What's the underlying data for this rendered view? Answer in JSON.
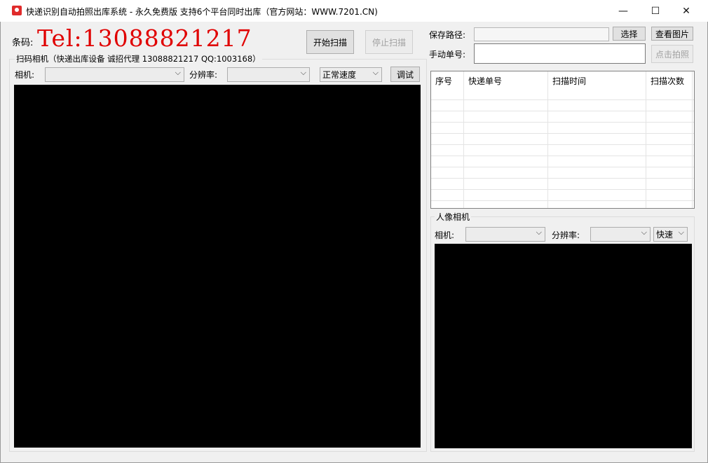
{
  "window": {
    "title": "快递识别自动拍照出库系统 - 永久免费版 支持6个平台同时出库（官方网站：WWW.7201.CN)",
    "minimize_glyph": "—",
    "maximize_glyph": "☐",
    "close_glyph": "✕"
  },
  "barcode": {
    "label": "条码:",
    "value": "Tel:13088821217"
  },
  "toolbar": {
    "start_scan": "开始扫描",
    "stop_scan": "停止扫描"
  },
  "scan_camera": {
    "group_title": "扫码相机（快递出库设备 诚招代理 13088821217 QQ:1003168）",
    "camera_label": "相机:",
    "camera_value": "",
    "resolution_label": "分辨率:",
    "resolution_value": "",
    "speed_value": "正常速度",
    "debug_button": "调试"
  },
  "save": {
    "path_label": "保存路径:",
    "path_value": "",
    "choose_button": "选择",
    "view_button": "查看图片"
  },
  "manual": {
    "label": "手动单号:",
    "value": "",
    "shoot_button": "点击拍照"
  },
  "table": {
    "columns": [
      "序号",
      "快递单号",
      "扫描时间",
      "扫描次数"
    ],
    "rows": []
  },
  "portrait_camera": {
    "group_title": "人像相机",
    "camera_label": "相机:",
    "camera_value": "",
    "resolution_label": "分辨率:",
    "resolution_value": "",
    "speed_value": "快速"
  },
  "colors": {
    "barcode_text": "#e00000",
    "window_bg": "#f0f0f0",
    "preview_bg": "#000000",
    "app_icon": "#e02b2b"
  },
  "icons": {
    "app": "app-icon",
    "dropdown": "chevron-down-icon"
  }
}
